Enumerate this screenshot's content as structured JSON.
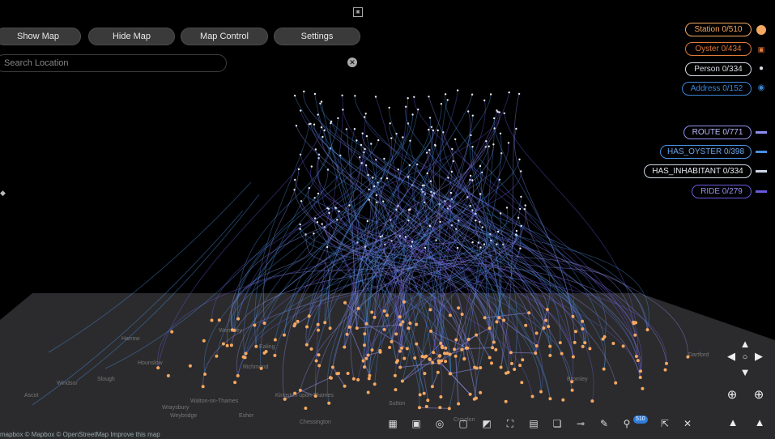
{
  "top_buttons": {
    "show_map": "Show Map",
    "hide_map": "Hide Map",
    "map_control": "Map Control",
    "settings": "Settings"
  },
  "search": {
    "placeholder": "Search Location"
  },
  "legend_nodes": [
    {
      "label": "Station 0/510",
      "color": "#f5a861",
      "icon": "circle-icon"
    },
    {
      "label": "Oyster 0/434",
      "color": "#e07a3a",
      "icon": "card-icon"
    },
    {
      "label": "Person 0/334",
      "color": "#d8dde6",
      "icon": "person-icon"
    },
    {
      "label": "Address 0/152",
      "color": "#3d86d8",
      "icon": "location-icon"
    }
  ],
  "legend_edges": [
    {
      "label": "ROUTE 0/771",
      "color": "#8f8ff0"
    },
    {
      "label": "HAS_OYSTER 0/398",
      "color": "#4a90e2"
    },
    {
      "label": "HAS_INHABITANT 0/334",
      "color": "#cfd8e6"
    },
    {
      "label": "RIDE 0/279",
      "color": "#6a5ae0"
    }
  ],
  "map_labels": [
    "Wraysbury",
    "Walton-on-Thames",
    "Weybridge",
    "Esher",
    "Kingston upon Thames",
    "Richmond",
    "Hounslow",
    "Ealing",
    "Wembley",
    "Harrow",
    "Croydon",
    "Sutton",
    "Bromley",
    "Dartford",
    "Chessington",
    "Ascot",
    "Windsor",
    "Slough"
  ],
  "toolbar_badge": "510",
  "attribution": "mapbox  © Mapbox © OpenStreetMap Improve this map",
  "colors": {
    "station": "#f5a861",
    "route": "#8f8ff0",
    "oyster_line": "#4a90e2",
    "ride": "#6a5ae0",
    "map_plane": "#2b2b2d"
  }
}
